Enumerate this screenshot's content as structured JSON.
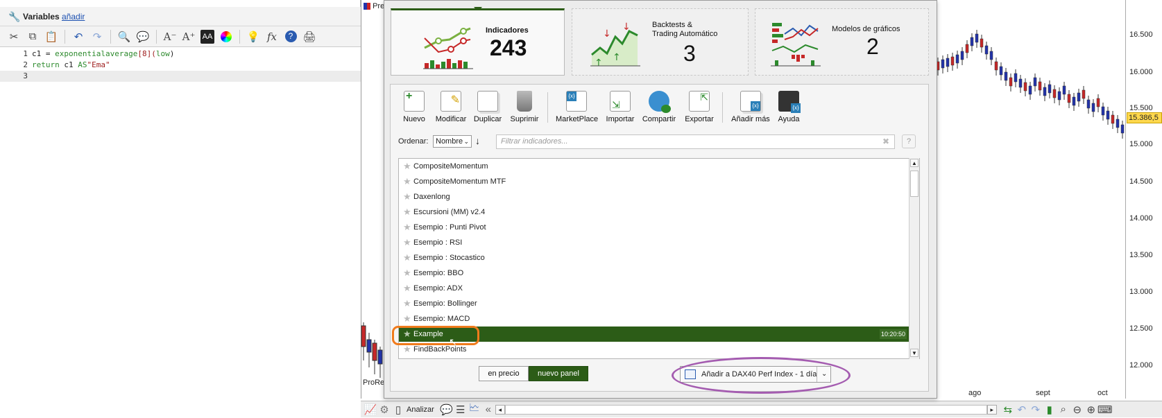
{
  "editor": {
    "title": "Variables",
    "add_link": "añadir",
    "lines": [
      {
        "num": "1",
        "parts": [
          {
            "t": "c1 = ",
            "c": ""
          },
          {
            "t": "exponentialaverage",
            "c": "kw"
          },
          {
            "t": "[8](",
            "c": "num"
          },
          {
            "t": "low",
            "c": "kw"
          },
          {
            "t": ")",
            "c": ""
          }
        ]
      },
      {
        "num": "2",
        "parts": [
          {
            "t": "return",
            "c": "kw"
          },
          {
            "t": " c1 ",
            "c": ""
          },
          {
            "t": "AS",
            "c": "kw"
          },
          {
            "t": "\"Ema\"",
            "c": "str"
          }
        ]
      },
      {
        "num": "3",
        "parts": []
      }
    ]
  },
  "chart": {
    "window_title": "Pre",
    "left_label": "ProRe",
    "current_price": "15.386,5",
    "price_labels": [
      "16.500",
      "16.000",
      "15.500",
      "15.000",
      "14.500",
      "14.000",
      "13.500",
      "13.000",
      "12.500",
      "12.000"
    ],
    "time_labels": [
      "ago",
      "sept",
      "oct"
    ],
    "analyze_label": "Analizar"
  },
  "popup": {
    "cards": [
      {
        "title": "Indicadores",
        "count": "243"
      },
      {
        "title_line1": "Backtests &",
        "title_line2": "Trading Automático",
        "count": "3"
      },
      {
        "title": "Modelos de gráficos",
        "count": "2"
      }
    ],
    "actions": [
      "Nuevo",
      "Modificar",
      "Duplicar",
      "Suprimir",
      "MarketPlace",
      "Importar",
      "Compartir",
      "Exportar",
      "Añadir más",
      "Ayuda"
    ],
    "sort_label": "Ordenar:",
    "sort_value": "Nombre",
    "filter_placeholder": "Filtrar indicadores...",
    "list": [
      "CompositeMomentum",
      "CompositeMomentum MTF",
      "Daxenlong",
      "Escursioni (MM) v2.4",
      "Esempio : Punti Pivot",
      "Esempio : RSI",
      "Esempio : Stocastico",
      "Esempio:  BBO",
      "Esempio: ADX",
      "Esempio: Bollinger",
      "Esempio: MACD",
      "Example",
      "FindBackPoints"
    ],
    "selected_time": "10:20:50",
    "btn_on_price": "en precio",
    "btn_new_panel": "nuevo panel",
    "add_to": "Añadir a DAX40 Perf Index - 1 día"
  },
  "colors": {
    "accent_green": "#2c5c17",
    "highlight_orange": "#f07b1c",
    "highlight_purple": "#a45cb0"
  }
}
